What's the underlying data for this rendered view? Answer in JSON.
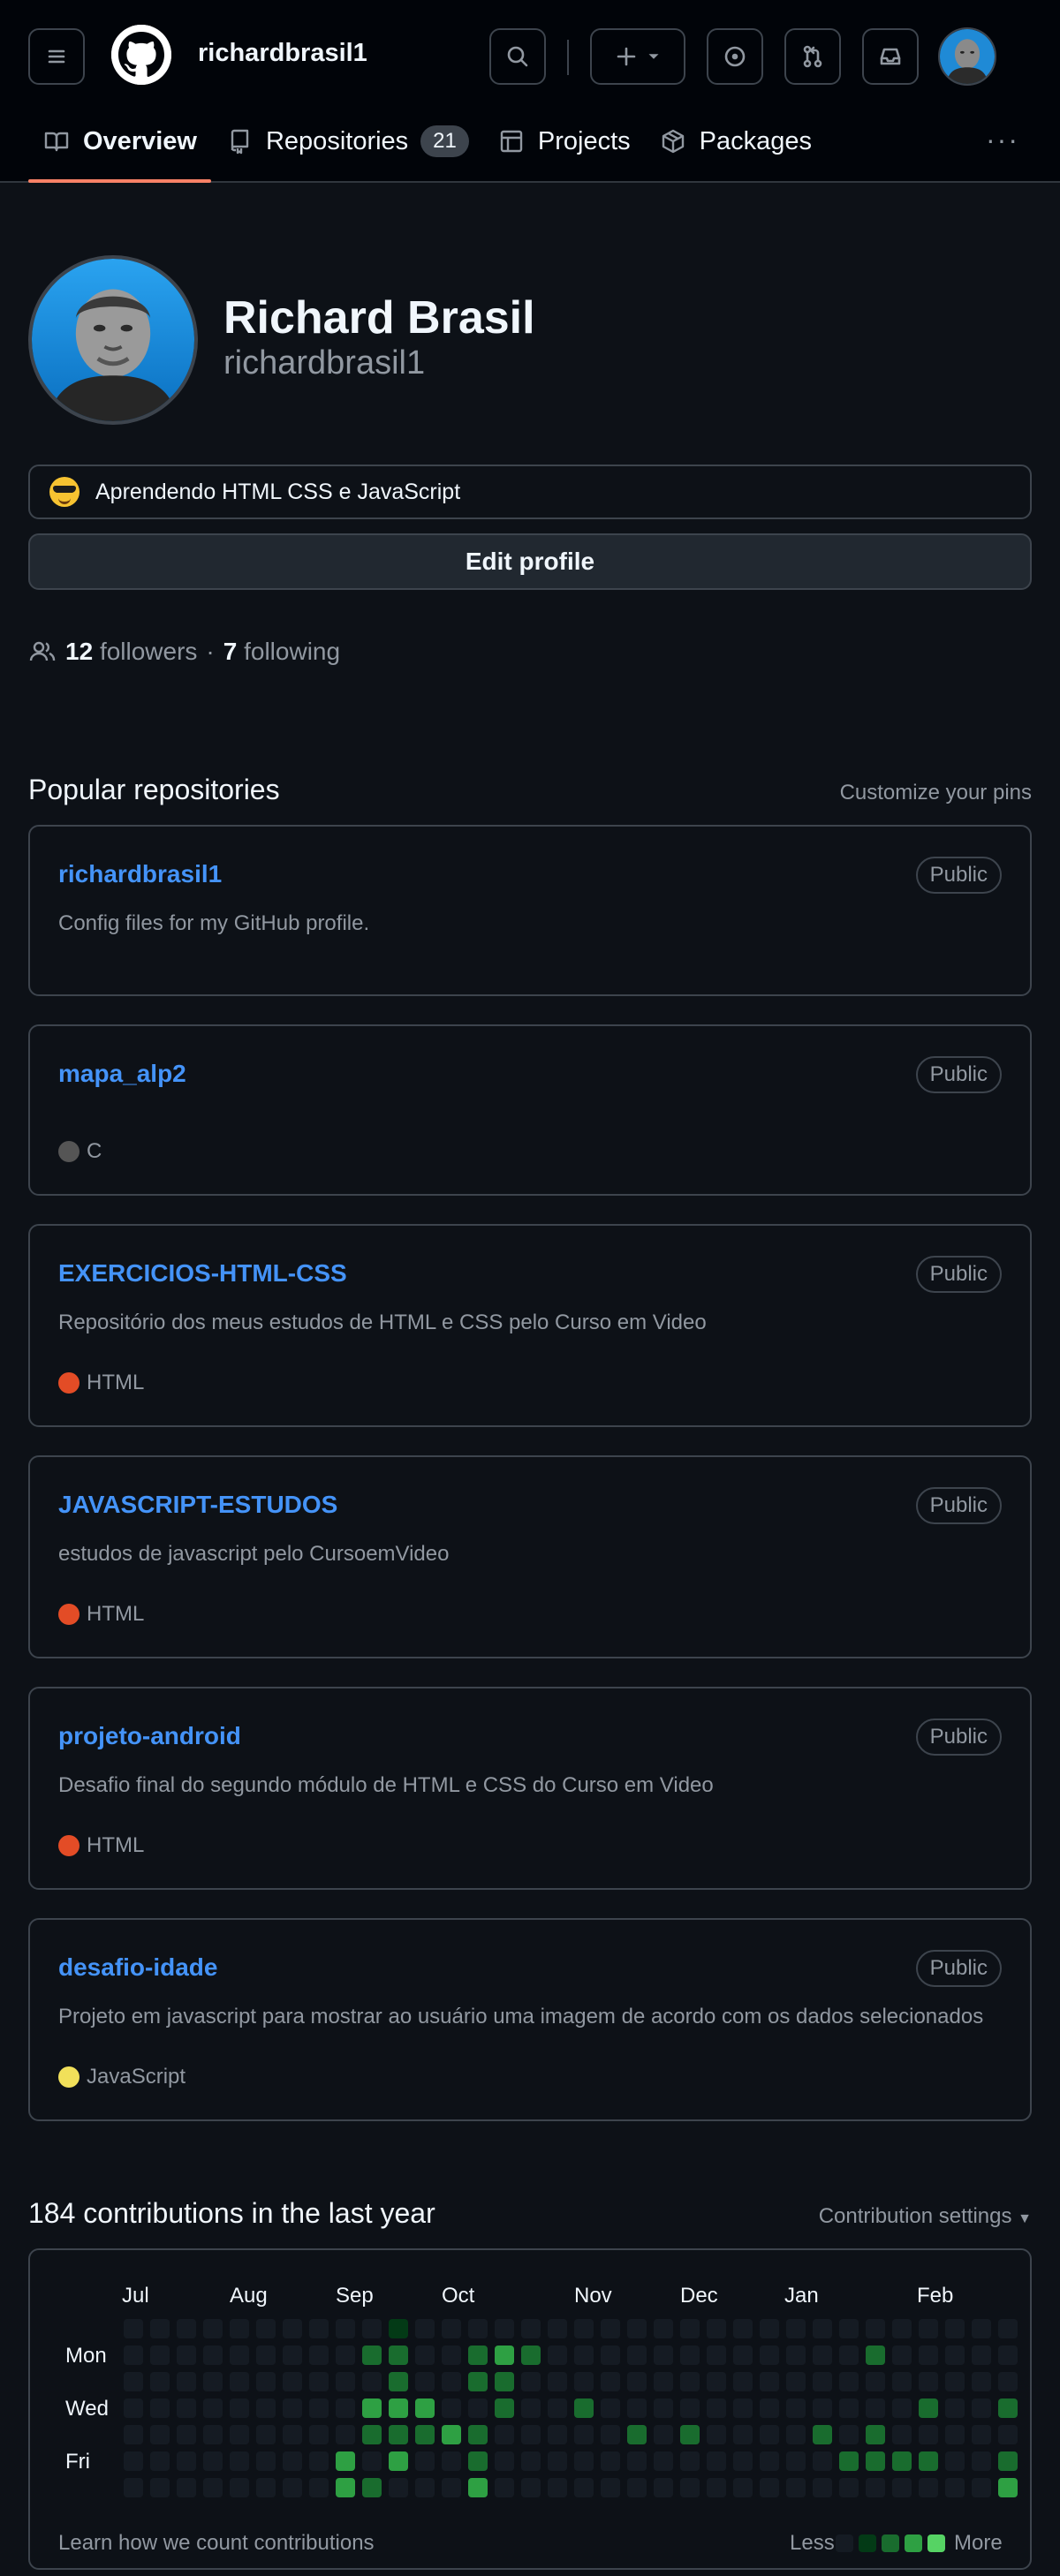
{
  "header": {
    "username": "richardbrasil1",
    "tabs": [
      {
        "label": "Overview",
        "icon": "book-icon"
      },
      {
        "label": "Repositories",
        "icon": "repo-icon",
        "count": "21"
      },
      {
        "label": "Projects",
        "icon": "table-icon"
      },
      {
        "label": "Packages",
        "icon": "package-icon"
      }
    ]
  },
  "profile": {
    "full_name": "Richard Brasil",
    "handle": "richardbrasil1",
    "status": "Aprendendo HTML CSS e JavaScript",
    "edit_label": "Edit profile",
    "followers_count": "12",
    "followers_label": "followers",
    "separator": "·",
    "following_count": "7",
    "following_label": "following"
  },
  "popular": {
    "title": "Popular repositories",
    "customize_label": "Customize your pins",
    "repos": [
      {
        "name": "richardbrasil1",
        "visibility": "Public",
        "description": "Config files for my GitHub profile.",
        "language": "",
        "lang_color": ""
      },
      {
        "name": "mapa_alp2",
        "visibility": "Public",
        "description": "",
        "language": "C",
        "lang_color": "#555555"
      },
      {
        "name": "EXERCICIOS-HTML-CSS",
        "visibility": "Public",
        "description": "Repositório dos meus estudos de HTML e CSS pelo Curso em Video",
        "language": "HTML",
        "lang_color": "#e34c26"
      },
      {
        "name": "JAVASCRIPT-ESTUDOS",
        "visibility": "Public",
        "description": "estudos de javascript pelo CursoemVideo",
        "language": "HTML",
        "lang_color": "#e34c26"
      },
      {
        "name": "projeto-android",
        "visibility": "Public",
        "description": "Desafio final do segundo módulo de HTML e CSS do Curso em Video",
        "language": "HTML",
        "lang_color": "#e34c26"
      },
      {
        "name": "desafio-idade",
        "visibility": "Public",
        "description": "Projeto em javascript para mostrar ao usuário uma imagem de acordo com os dados selecionados",
        "language": "JavaScript",
        "lang_color": "#f1e05a"
      }
    ]
  },
  "contributions": {
    "title": "184 contributions in the last year",
    "settings_label": "Contribution settings",
    "months": [
      "Jul",
      "Aug",
      "Sep",
      "Oct",
      "Nov",
      "Dec",
      "Jan",
      "Feb"
    ],
    "days": [
      "Mon",
      "Wed",
      "Fri"
    ],
    "footer_link": "Learn how we count contributions",
    "less_label": "Less",
    "more_label": "More",
    "level_colors": [
      "#151b23",
      "#033a16",
      "#196c2e",
      "#2ea043",
      "#56d364"
    ],
    "grid_levels": [
      [
        0,
        0,
        0,
        0,
        0,
        0,
        0,
        0,
        0,
        0,
        1,
        0,
        0,
        0,
        0,
        0,
        0,
        0,
        0,
        0,
        0,
        0,
        0,
        0,
        0,
        0,
        0,
        0,
        0,
        0,
        0,
        0,
        0,
        0
      ],
      [
        0,
        0,
        0,
        0,
        0,
        0,
        0,
        0,
        0,
        2,
        2,
        0,
        0,
        2,
        3,
        2,
        0,
        0,
        0,
        0,
        0,
        0,
        0,
        0,
        0,
        0,
        0,
        0,
        2,
        0,
        0,
        0,
        0,
        0
      ],
      [
        0,
        0,
        0,
        0,
        0,
        0,
        0,
        0,
        0,
        0,
        2,
        0,
        0,
        2,
        2,
        0,
        0,
        0,
        0,
        0,
        0,
        0,
        0,
        0,
        0,
        0,
        0,
        0,
        0,
        0,
        0,
        0,
        0,
        0
      ],
      [
        0,
        0,
        0,
        0,
        0,
        0,
        0,
        0,
        0,
        3,
        3,
        3,
        0,
        0,
        2,
        0,
        0,
        2,
        0,
        0,
        0,
        0,
        0,
        0,
        0,
        0,
        0,
        0,
        0,
        0,
        2,
        0,
        0,
        2
      ],
      [
        0,
        0,
        0,
        0,
        0,
        0,
        0,
        0,
        0,
        2,
        2,
        2,
        3,
        2,
        0,
        0,
        0,
        0,
        0,
        2,
        0,
        2,
        0,
        0,
        0,
        0,
        2,
        0,
        2,
        0,
        0,
        0,
        0,
        0
      ],
      [
        0,
        0,
        0,
        0,
        0,
        0,
        0,
        0,
        3,
        0,
        3,
        0,
        0,
        2,
        0,
        0,
        0,
        0,
        0,
        0,
        0,
        0,
        0,
        0,
        0,
        0,
        0,
        2,
        2,
        2,
        2,
        0,
        0,
        2
      ],
      [
        0,
        0,
        0,
        0,
        0,
        0,
        0,
        0,
        3,
        2,
        0,
        0,
        0,
        3,
        0,
        0,
        0,
        0,
        0,
        0,
        0,
        0,
        0,
        0,
        0,
        0,
        0,
        0,
        0,
        0,
        0,
        0,
        0,
        3
      ]
    ]
  }
}
